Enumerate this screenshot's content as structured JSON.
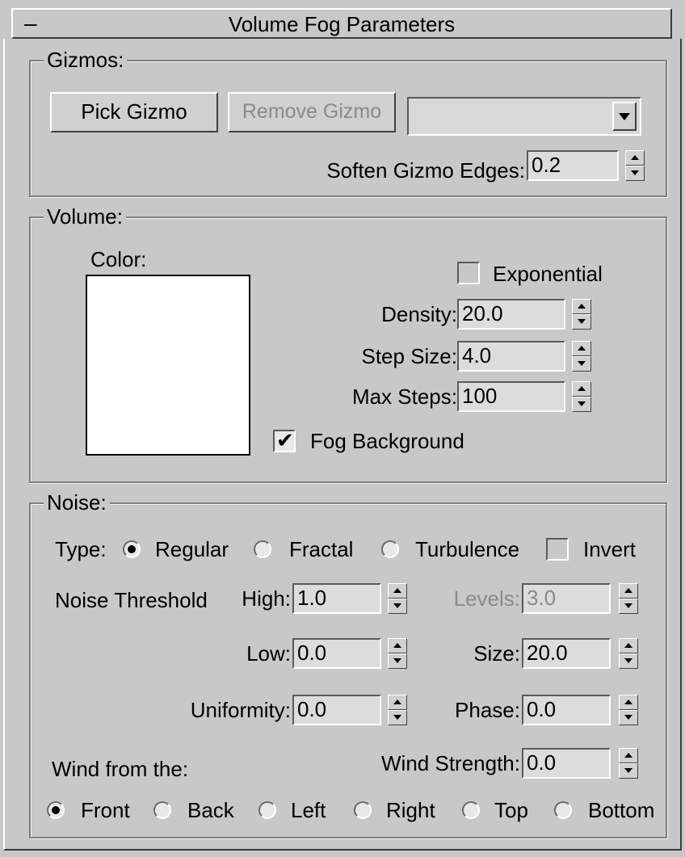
{
  "rollout": {
    "collapse_symbol": "–",
    "title": "Volume Fog Parameters"
  },
  "gizmos": {
    "group_label": "Gizmos:",
    "pick_button": "Pick Gizmo",
    "remove_button": "Remove Gizmo",
    "dropdown_value": "",
    "soften_label": "Soften Gizmo Edges:",
    "soften_value": "0.2"
  },
  "volume": {
    "group_label": "Volume:",
    "color_label": "Color:",
    "color_value": "#ffffff",
    "exponential_label": "Exponential",
    "exponential_checked": false,
    "density_label": "Density:",
    "density_value": "20.0",
    "step_size_label": "Step Size:",
    "step_size_value": "4.0",
    "max_steps_label": "Max Steps:",
    "max_steps_value": "100",
    "fog_background_label": "Fog Background",
    "fog_background_checked": true,
    "check_mark": "✔"
  },
  "noise": {
    "group_label": "Noise:",
    "type_label": "Type:",
    "type_options": [
      "Regular",
      "Fractal",
      "Turbulence"
    ],
    "type_selected": "Regular",
    "invert_label": "Invert",
    "invert_checked": false,
    "threshold_label": "Noise Threshold",
    "high_label": "High:",
    "high_value": "1.0",
    "low_label": "Low:",
    "low_value": "0.0",
    "uniformity_label": "Uniformity:",
    "uniformity_value": "0.0",
    "levels_label": "Levels:",
    "levels_value": "3.0",
    "size_label": "Size:",
    "size_value": "20.0",
    "phase_label": "Phase:",
    "phase_value": "0.0",
    "wind_strength_label": "Wind Strength:",
    "wind_strength_value": "0.0",
    "wind_from_label": "Wind from the:",
    "wind_options": [
      "Front",
      "Back",
      "Left",
      "Right",
      "Top",
      "Bottom"
    ],
    "wind_selected": "Front"
  }
}
